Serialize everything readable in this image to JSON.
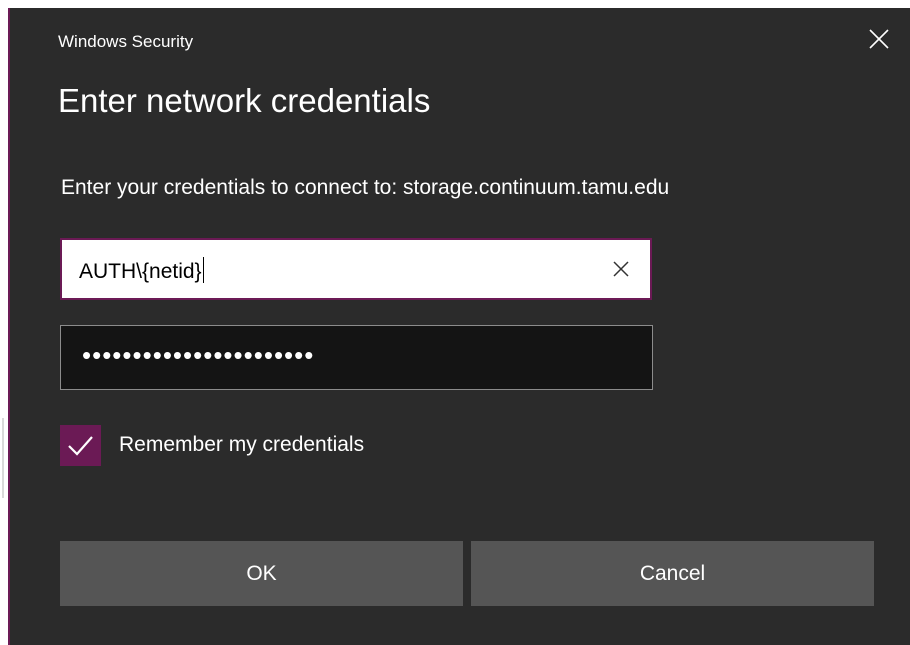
{
  "window": {
    "title": "Windows Security",
    "close_icon": "close-icon"
  },
  "dialog": {
    "heading": "Enter network credentials",
    "description": "Enter your credentials to connect to: storage.continuum.tamu.edu"
  },
  "username": {
    "value": "AUTH\\{netid}",
    "clear_icon": "clear-icon"
  },
  "password": {
    "masked_value": "•••••••••••••••••••••••"
  },
  "remember": {
    "label": "Remember my credentials",
    "checked": true
  },
  "buttons": {
    "ok_label": "OK",
    "cancel_label": "Cancel"
  },
  "colors": {
    "background": "#2b2b2b",
    "accent": "#6b1a55",
    "button": "#555555",
    "password_field": "#141414"
  }
}
